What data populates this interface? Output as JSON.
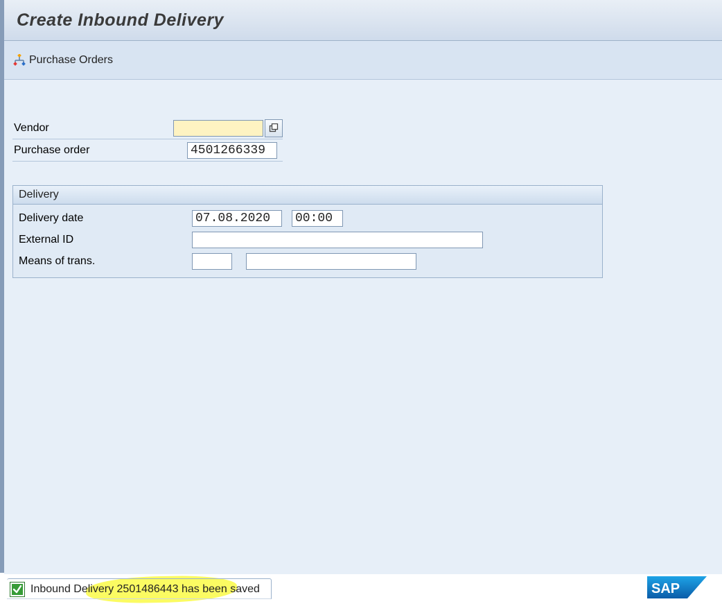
{
  "app": {
    "title": "Create Inbound Delivery"
  },
  "toolbar": {
    "purchase_orders_label": "Purchase Orders"
  },
  "form": {
    "vendor_label": "Vendor",
    "vendor_value": "",
    "po_label": "Purchase order",
    "po_value": "4501266339"
  },
  "delivery": {
    "group_title": "Delivery",
    "date_label": "Delivery date",
    "date_value": "07.08.2020",
    "time_value": "00:00",
    "ext_id_label": "External ID",
    "ext_id_value": "",
    "mot_label": "Means of trans.",
    "mot_code": "",
    "mot_text": ""
  },
  "status": {
    "message": "Inbound Delivery 2501486443 has been saved"
  }
}
